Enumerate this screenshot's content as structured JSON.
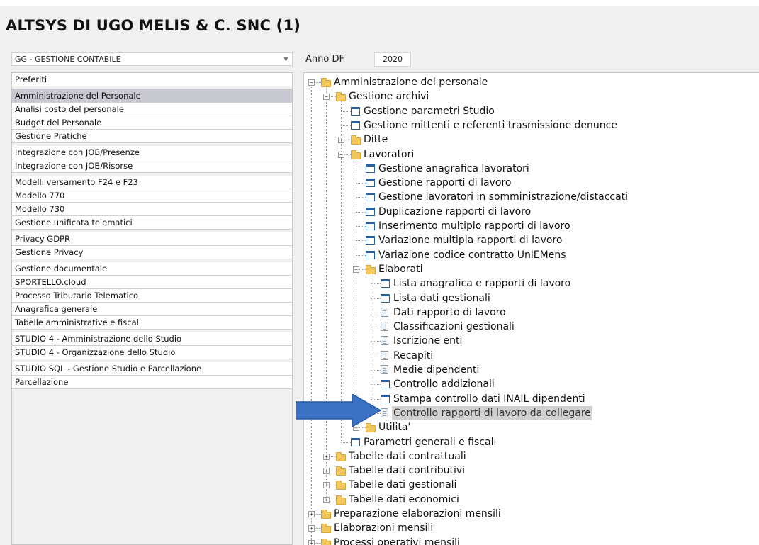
{
  "header": {
    "title": "ALTSYS DI UGO MELIS & C. SNC (1)"
  },
  "module_select": {
    "value": "GG - GESTIONE CONTABILE"
  },
  "anno": {
    "label": "Anno DF",
    "value": "2020"
  },
  "menu": {
    "items": [
      {
        "label": "Preferiti"
      },
      {
        "label": "Amministrazione del Personale"
      },
      {
        "label": "Analisi costo del personale"
      },
      {
        "label": "Budget del Personale"
      },
      {
        "label": "Gestione Pratiche"
      },
      {
        "label": "Integrazione con JOB/Presenze"
      },
      {
        "label": "Integrazione con JOB/Risorse"
      },
      {
        "label": "Modelli versamento F24 e F23"
      },
      {
        "label": "Modello 770"
      },
      {
        "label": "Modello 730"
      },
      {
        "label": "Gestione unificata telematici"
      },
      {
        "label": "Privacy GDPR"
      },
      {
        "label": "Gestione Privacy"
      },
      {
        "label": "Gestione documentale"
      },
      {
        "label": "SPORTELLO.cloud"
      },
      {
        "label": "Processo Tributario Telematico"
      },
      {
        "label": "Anagrafica generale"
      },
      {
        "label": "Tabelle amministrative e fiscali"
      },
      {
        "label": "STUDIO 4 - Amministrazione dello Studio"
      },
      {
        "label": "STUDIO 4 - Organizzazione dello Studio"
      },
      {
        "label": "STUDIO SQL - Gestione Studio e Parcellazione"
      },
      {
        "label": "Parcellazione"
      }
    ]
  },
  "tree": {
    "nodes": [
      {
        "label": "Amministrazione del personale",
        "icon": "folder-icon",
        "expander": "−"
      },
      {
        "label": "Gestione archivi",
        "icon": "folder-icon",
        "expander": "−"
      },
      {
        "label": "Gestione parametri Studio",
        "icon": "form-icon",
        "expander": ""
      },
      {
        "label": "Gestione mittenti e referenti trasmissione denunce",
        "icon": "form-icon",
        "expander": ""
      },
      {
        "label": "Ditte",
        "icon": "folder-icon",
        "expander": "+"
      },
      {
        "label": "Lavoratori",
        "icon": "folder-icon",
        "expander": "−"
      },
      {
        "label": "Gestione anagrafica lavoratori",
        "icon": "form-icon",
        "expander": ""
      },
      {
        "label": "Gestione rapporti di lavoro",
        "icon": "form-icon",
        "expander": ""
      },
      {
        "label": "Gestione lavoratori in somministrazione/distaccati",
        "icon": "form-icon",
        "expander": ""
      },
      {
        "label": "Duplicazione rapporti di lavoro",
        "icon": "form-icon",
        "expander": ""
      },
      {
        "label": "Inserimento multiplo rapporti di lavoro",
        "icon": "form-icon",
        "expander": ""
      },
      {
        "label": "Variazione multipla rapporti di lavoro",
        "icon": "form-icon",
        "expander": ""
      },
      {
        "label": "Variazione codice contratto UniEMens",
        "icon": "form-icon",
        "expander": ""
      },
      {
        "label": "Elaborati",
        "icon": "folder-icon",
        "expander": "−"
      },
      {
        "label": "Lista anagrafica e rapporti di lavoro",
        "icon": "form-icon",
        "expander": ""
      },
      {
        "label": "Lista dati gestionali",
        "icon": "form-icon",
        "expander": ""
      },
      {
        "label": "Dati rapporto di lavoro",
        "icon": "report-icon",
        "expander": ""
      },
      {
        "label": "Classificazioni gestionali",
        "icon": "report-icon",
        "expander": ""
      },
      {
        "label": "Iscrizione enti",
        "icon": "report-icon",
        "expander": ""
      },
      {
        "label": "Recapiti",
        "icon": "report-icon",
        "expander": ""
      },
      {
        "label": "Medie dipendenti",
        "icon": "report-icon",
        "expander": ""
      },
      {
        "label": "Controllo addizionali",
        "icon": "form-icon",
        "expander": ""
      },
      {
        "label": "Stampa controllo dati INAIL dipendenti",
        "icon": "form-icon",
        "expander": ""
      },
      {
        "label": "Controllo rapporti di lavoro da collegare",
        "icon": "report-icon",
        "expander": ""
      },
      {
        "label": "Utilita'",
        "icon": "folder-icon",
        "expander": "+"
      },
      {
        "label": "Parametri generali e fiscali",
        "icon": "form-icon",
        "expander": ""
      },
      {
        "label": "Tabelle dati contrattuali",
        "icon": "folder-icon",
        "expander": "+"
      },
      {
        "label": "Tabelle dati contributivi",
        "icon": "folder-icon",
        "expander": "+"
      },
      {
        "label": "Tabelle dati gestionali",
        "icon": "folder-icon",
        "expander": "+"
      },
      {
        "label": "Tabelle dati economici",
        "icon": "folder-icon",
        "expander": "+"
      },
      {
        "label": "Preparazione elaborazioni mensili",
        "icon": "folder-icon",
        "expander": "+"
      },
      {
        "label": "Elaborazioni mensili",
        "icon": "folder-icon",
        "expander": "+"
      },
      {
        "label": "Processi operativi mensili",
        "icon": "folder-icon",
        "expander": "+"
      }
    ]
  },
  "colors": {
    "arrow": "#3b72c4",
    "selected_row": "#c9c9d2",
    "folder": "#f2c75c",
    "form_icon": "#2a5f9e"
  }
}
